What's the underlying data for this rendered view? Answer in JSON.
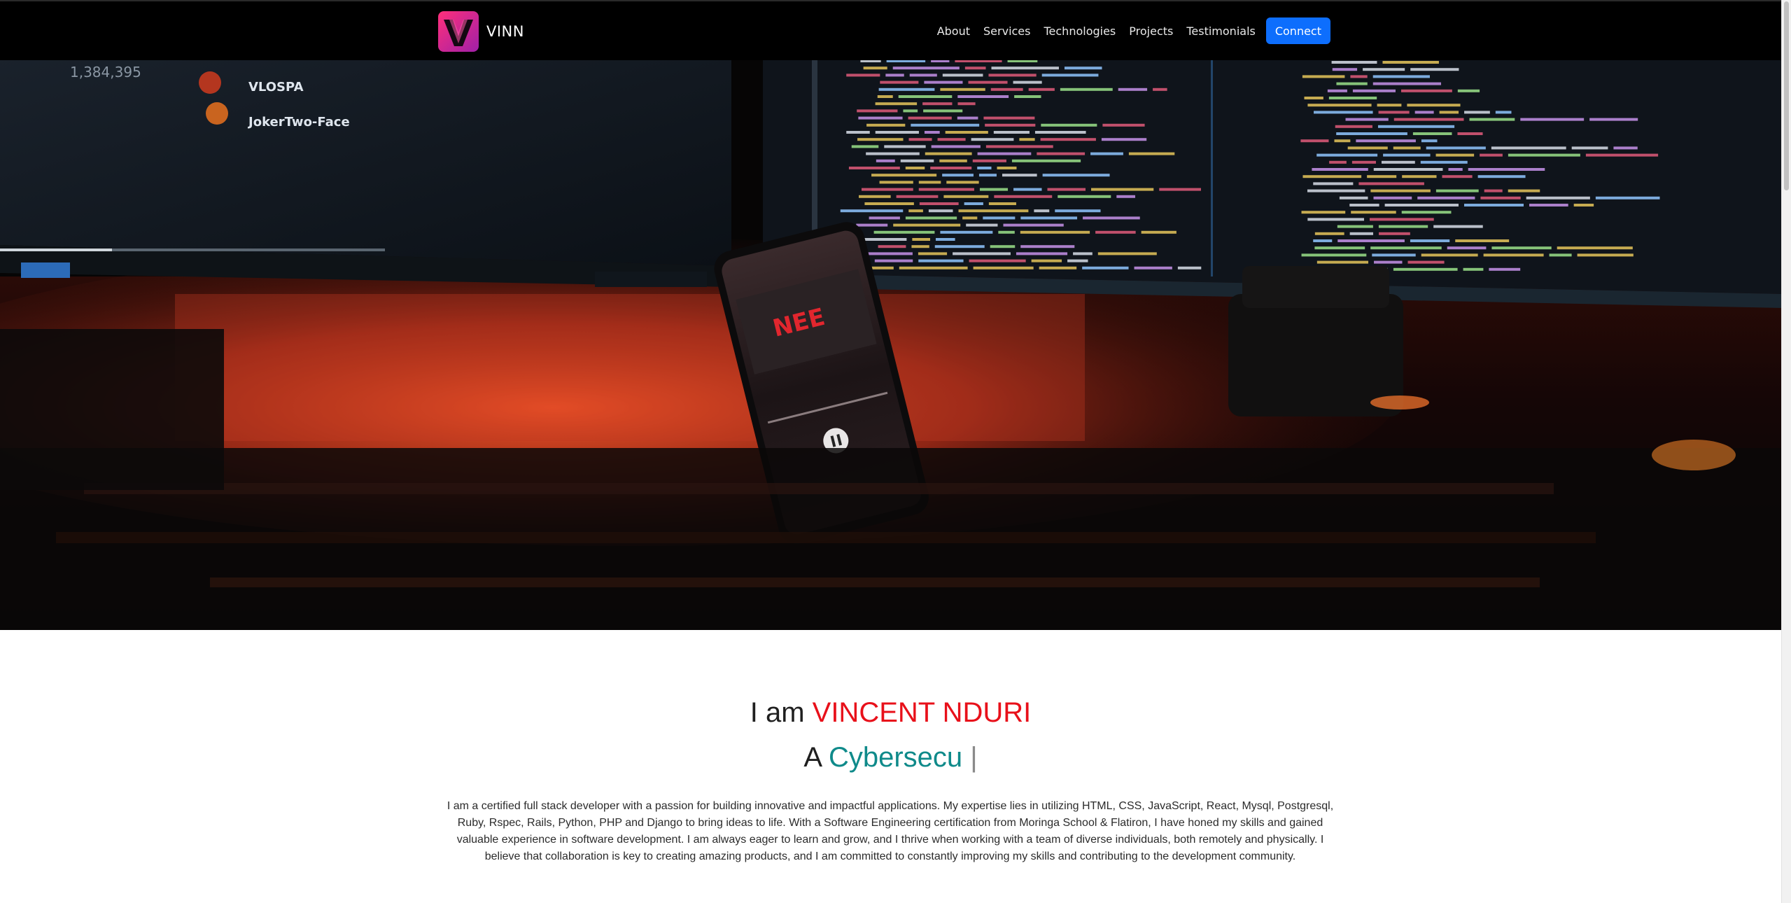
{
  "navbar": {
    "brand_name": "VINN",
    "links": [
      "About",
      "Services",
      "Technologies",
      "Projects",
      "Testimonials"
    ],
    "connect_label": "Connect"
  },
  "hero": {
    "image_description_icon": "desk-setup-photo"
  },
  "about": {
    "intro_prefix": "I am",
    "name": "VINCENT NDURI",
    "role_prefix": "A",
    "role_typed": "Cybersecu",
    "caret": "|",
    "bio": "I am a certified full stack developer with a passion for building innovative and impactful applications. My expertise lies in utilizing HTML, CSS, JavaScript, React, Mysql, Postgresql, Ruby, Rspec, Rails, Python, PHP and Django to bring ideas to life. With a Software Engineering certification from Moringa School & Flatiron, I have honed my skills and gained valuable experience in software development. I am always eager to learn and grow, and I thrive when working with a team of diverse individuals, both remotely and physically. I believe that collaboration is key to creating amazing products, and I am committed to constantly improving my skills and contributing to the development community."
  },
  "colors": {
    "nav_bg": "#000000",
    "connect_bg": "#0d6efd",
    "name_red": "#e8101a",
    "role_teal": "#0f8a8a"
  }
}
